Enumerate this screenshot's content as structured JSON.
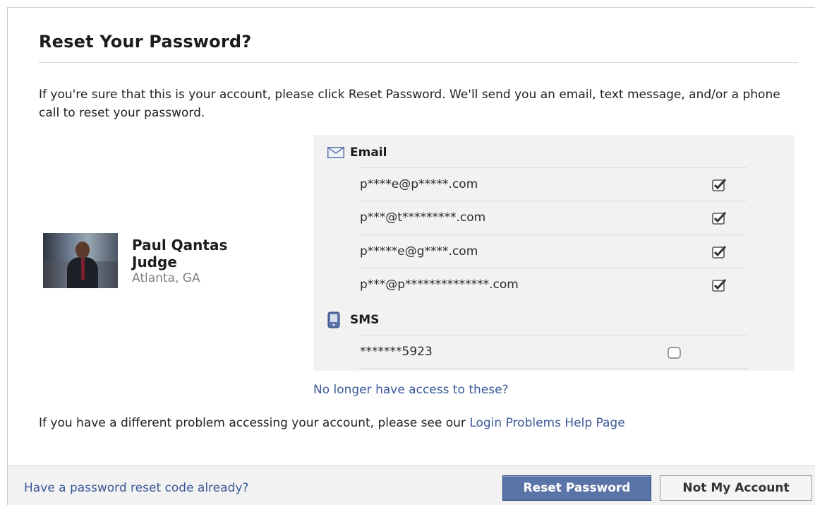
{
  "dialog": {
    "title": "Reset Your Password?",
    "intro": "If you're sure that this is your account, please click Reset Password. We'll send you an email, text message, and/or a phone call to reset your password."
  },
  "profile": {
    "name": "Paul Qantas Judge",
    "location": "Atlanta, GA"
  },
  "contacts": {
    "email_heading": "Email",
    "email_icon": "envelope-icon",
    "emails": [
      {
        "address": "p****e@p*****.com",
        "checked": true
      },
      {
        "address": "p***@t*********.com",
        "checked": true
      },
      {
        "address": "p*****e@g****.com",
        "checked": true
      },
      {
        "address": "p***@p**************.com",
        "checked": true
      }
    ],
    "sms_heading": "SMS",
    "sms_icon": "phone-icon",
    "sms": [
      {
        "number": "*******5923",
        "checked": false
      }
    ]
  },
  "links": {
    "no_access": "No longer have access to these?",
    "problem_prefix": "If you have a different problem accessing your account, please see our ",
    "problem_link": "Login Problems Help Page"
  },
  "footer": {
    "code_link": "Have a password reset code already?",
    "reset_button": "Reset Password",
    "not_mine_button": "Not My Account"
  },
  "colors": {
    "link": "#3b5998",
    "primary_button": "#5b74a8",
    "panel_bg": "#f2f2f2"
  }
}
